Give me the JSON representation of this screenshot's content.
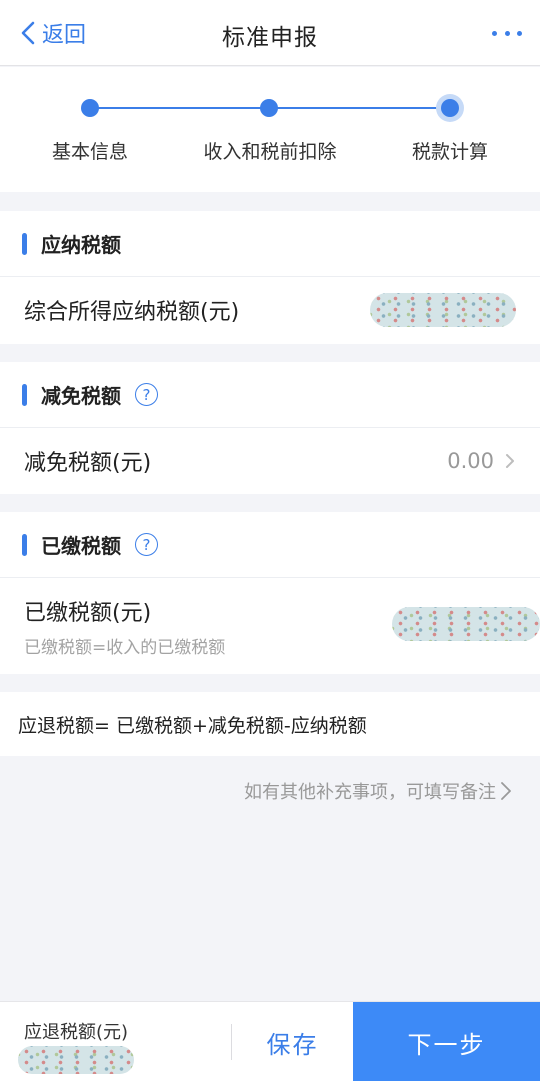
{
  "navbar": {
    "back_label": "返回",
    "title": "标准申报",
    "more_icon": "more-dots-icon"
  },
  "stepper": {
    "steps": [
      {
        "label": "基本信息",
        "state": "done"
      },
      {
        "label": "收入和税前扣除",
        "state": "done"
      },
      {
        "label": "税款计算",
        "state": "current"
      }
    ]
  },
  "tax_payable": {
    "title": "应纳税额",
    "row_label": "综合所得应纳税额(元)"
  },
  "tax_reduction": {
    "title": "减免税额",
    "help_icon": "question-circle-icon",
    "row_label": "减免税额(元)",
    "row_value": "0.00"
  },
  "tax_paid": {
    "title": "已缴税额",
    "help_icon": "question-circle-icon",
    "row_label": "已缴税额(元)",
    "row_sub": "已缴税额=收入的已缴税额"
  },
  "formula": "应退税额= 已缴税额+减免税额-应纳税额",
  "remark_link": "如有其他补充事项，可填写备注",
  "bottom": {
    "refund_label": "应退税额(元)",
    "save_label": "保存",
    "next_label": "下一步"
  },
  "colors": {
    "accent": "#3b7ee8",
    "primary_button": "#3d8af7",
    "background": "#f3f4f8"
  }
}
